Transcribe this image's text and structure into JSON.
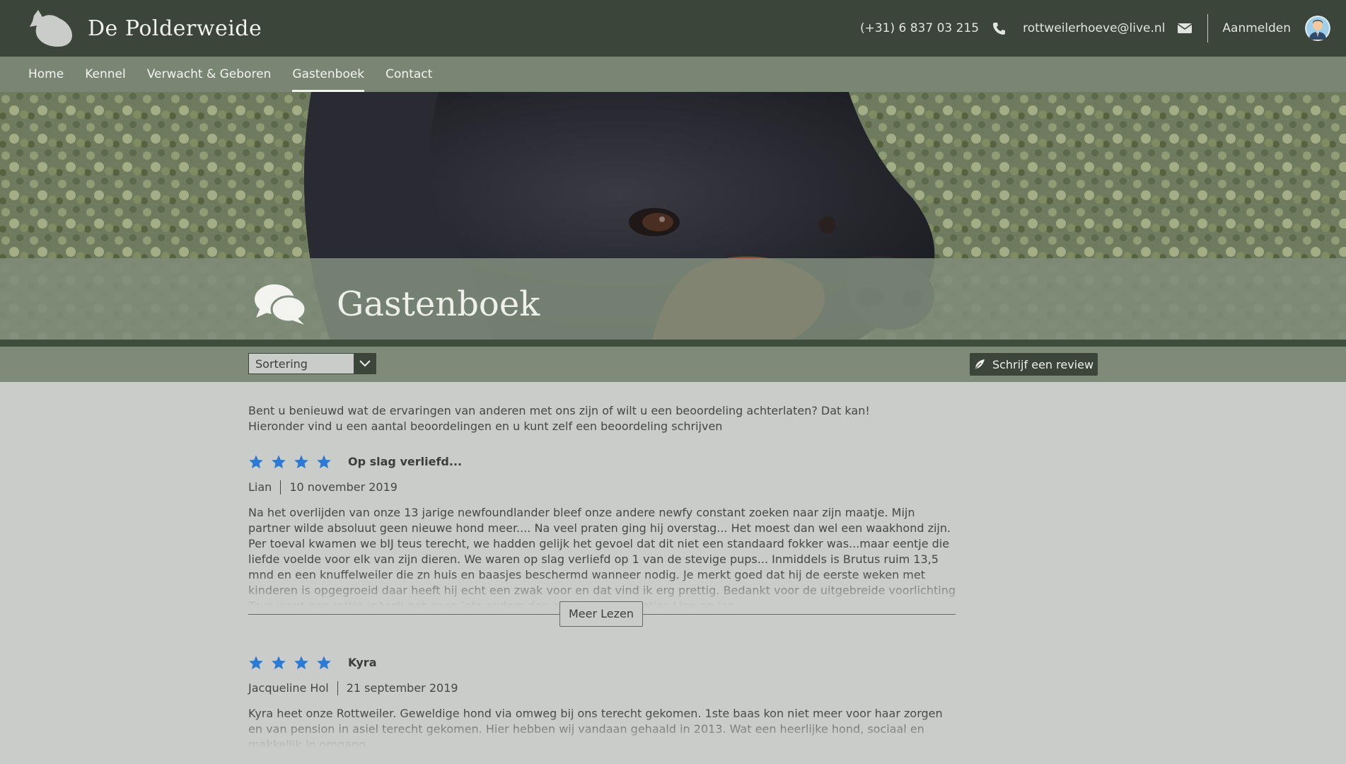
{
  "header": {
    "brand": "De Polderweide",
    "phone": "(+31) 6 837 03 215",
    "email": "rottweilerhoeve@live.nl",
    "login": "Aanmelden"
  },
  "nav": [
    {
      "label": "Home"
    },
    {
      "label": "Kennel"
    },
    {
      "label": "Verwacht & Geboren"
    },
    {
      "label": "Gastenboek",
      "active": true
    },
    {
      "label": "Contact"
    }
  ],
  "hero": {
    "title": "Gastenboek"
  },
  "toolbar": {
    "sort_value": "Sortering",
    "write_review": "Schrijf een review"
  },
  "intro": {
    "line1": "Bent u benieuwd wat de ervaringen van anderen met ons zijn of wilt u een beoordeling achterlaten? Dat kan!",
    "line2": "Hieronder vind u een aantal beoordelingen en u kunt zelf een beoordeling schrijven"
  },
  "reviews": [
    {
      "rating": 4,
      "title": "Op slag verliefd...",
      "author": "Lian",
      "date": "10 november 2019",
      "text": "Na het overlijden van onze 13 jarige newfoundlander bleef onze andere newfy constant zoeken naar zijn maatje. Mijn partner wilde absoluut geen nieuwe hond meer.... Na veel praten ging hij overstag... Het moest dan wel een waakhond zijn. Per toeval kwamen we bIJ teus terecht, we hadden gelijk het gevoel dat dit niet een standaard fokker was...maar eentje die liefde voelde voor elk van zijn dieren. We waren op slag verliefd op 1 van de stevige pups... Inmiddels is Brutus ruim 13,5 mnd en een knuffelweiler die zn huis en baasjes beschermd wanneer nodig. Je merkt goed dat hij de eerste weken met kinderen is opgegroeid daar heeft hij echt een zwak voor en dat vind ik erg prettig. Bedankt voor de uitgebreide voorlichting Teus want een rottie is toch net even iets anders dan een Newfy.. Groetjes Lian en Jan",
      "more": "Meer Lezen"
    },
    {
      "rating": 4,
      "title": "Kyra",
      "author": "Jacqueline Hol",
      "date": "21 september 2019",
      "text": "Kyra heet onze Rottweiler. Geweldige hond via omweg bij ons terecht gekomen. 1ste baas kon niet meer voor haar zorgen en van pension in asiel terecht gekomen. Hier hebben wij vandaan gehaald in 2013. Wat een heerlijke hond, sociaal en makkelijk in omgang."
    }
  ],
  "colors": {
    "header_bg": "#3b4539",
    "nav_bg": "#7a8674",
    "page_bg": "#c9ccc8",
    "star": "#2b7bd6"
  }
}
